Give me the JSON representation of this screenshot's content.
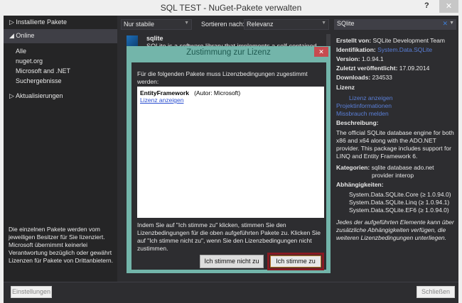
{
  "window": {
    "title": "SQL TEST - NuGet-Pakete verwalten",
    "help": "?",
    "close": "✕"
  },
  "sidebar": {
    "installed": "Installierte Pakete",
    "online": "Online",
    "sub": [
      "Alle",
      "nuget.org",
      "Microsoft and .NET",
      "Suchergebnisse"
    ],
    "updates": "Aktualisierungen",
    "disclaimer": "Die einzelnen Pakete werden vom jeweiligen Besitzer für Sie lizenziert. Microsoft übernimmt keinerlei Verantwortung bezüglich oder gewährt Lizenzen für Pakete von Drittanbietern."
  },
  "toolbar": {
    "filter": "Nur stabile",
    "sort_label": "Sortieren nach:",
    "sort": "Relevanz",
    "search": "SQlite"
  },
  "list": {
    "name": "sqlite",
    "desc": "SQLite is a software library that implements a self-contained"
  },
  "details": {
    "created_label": "Erstellt von:",
    "created": "SQLite Development Team",
    "id_label": "Identifikation:",
    "id": "System.Data.SQLite",
    "version_label": "Version:",
    "version": "1.0.94.1",
    "published_label": "Zuletzt veröffentlicht:",
    "published": "17.09.2014",
    "downloads_label": "Downloads:",
    "downloads": "234533",
    "license_heading": "Lizenz",
    "license_link": "Lizenz anzeigen",
    "project_link": "Projektinformationen",
    "abuse_link": "Missbrauch melden",
    "desc_heading": "Beschreibung:",
    "desc": "The official SQLite database engine for both x86 and x64 along with the ADO.NET provider. This package includes support for LINQ and Entity Framework 6.",
    "cat_label": "Kategorien:",
    "cat1": "sqlite database ado.net",
    "cat2": "provider interop",
    "deps_heading": "Abhängigkeiten:",
    "deps": [
      "System.Data.SQLite.Core (≥ 1.0.94.0)",
      "System.Data.SQLite.Linq (≥ 1.0.94.1)",
      "System.Data.SQLite.EF6 (≥ 1.0.94.0)"
    ],
    "note": "Jedes der aufgeführten Elemente kann über zusätzliche Abhängigkeiten verfügen, die weiteren Lizenzbedingungen unterliegen."
  },
  "footer": {
    "settings": "Einstellungen",
    "close": "Schließen"
  },
  "dialog": {
    "title": "Zustimmung zur Lizenz",
    "close": "✕",
    "message": "Für die folgenden Pakete muss Lizenzbedingungen zugestimmt werden:",
    "package": "EntityFramework",
    "author": "(Autor: Microsoft)",
    "license_link": "Lizenz anzeigen",
    "agreement": "Indem Sie auf \"Ich stimme zu\" klicken, stimmen Sie den Lizenzbedingungen für die oben aufgeführten Pakete zu. Klicken Sie auf \"Ich stimme nicht zu\", wenn Sie den Lizenzbedingungen nicht zustimmen.",
    "decline": "Ich stimme nicht zu",
    "accept": "Ich stimme zu"
  }
}
